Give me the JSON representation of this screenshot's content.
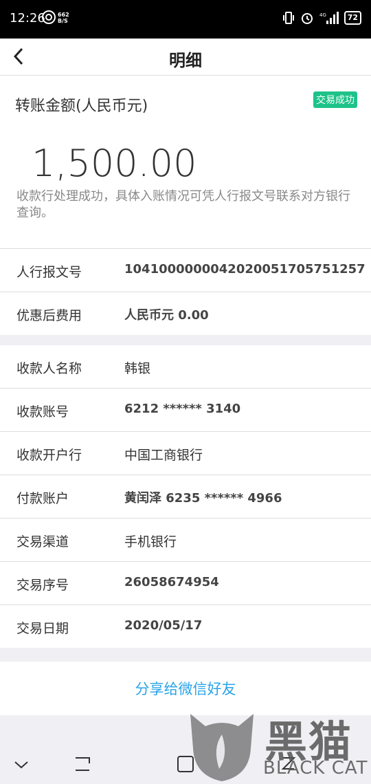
{
  "status_bar": {
    "time": "12:26",
    "speed_value": "662",
    "speed_unit": "B/S",
    "network": "4G",
    "battery": "72"
  },
  "header": {
    "title": "明细"
  },
  "amount_card": {
    "label": "转账金额(人民币元)",
    "status_badge": "交易成功",
    "amount": "1,500.00",
    "note": "收款行处理成功，具体入账情况可凭人行报文号联系对方银行查询。"
  },
  "group1": [
    {
      "label": "人行报文号",
      "value": "104100000004202005170575125​7"
    },
    {
      "label": "优惠后费用",
      "value": "人民币元 0.00"
    }
  ],
  "group2": [
    {
      "label": "收款人名称",
      "value": "韩银"
    },
    {
      "label": "收款账号",
      "value": "6212 ****** 3140"
    },
    {
      "label": "收款开户行",
      "value": "中国工商银行"
    },
    {
      "label": "付款账户",
      "value": "黄闰泽 6235 ****** 4966"
    },
    {
      "label": "交易渠道",
      "value": "手机银行"
    },
    {
      "label": "交易序号",
      "value": "26058674954"
    },
    {
      "label": "交易日期",
      "value": "2020/05/17"
    }
  ],
  "share": {
    "label": "分享给微信好友"
  },
  "watermark": {
    "cn": "黑猫",
    "en": "BLACK CAT"
  },
  "icons": [
    "back-arrow-icon",
    "vibrate-icon",
    "alarm-icon",
    "signal-icon",
    "battery-icon",
    "nav-back-icon",
    "nav-home-icon",
    "nav-recent-icon"
  ]
}
